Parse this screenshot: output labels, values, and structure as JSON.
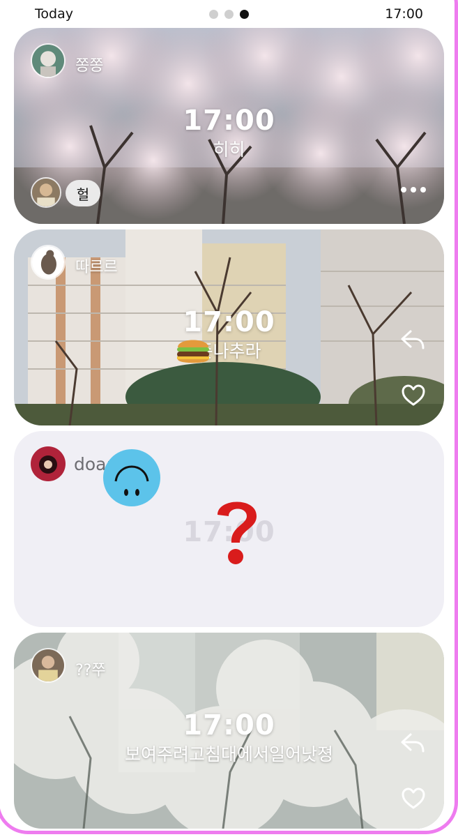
{
  "status_bar": {
    "left_label": "Today",
    "time": "17:00"
  },
  "cards": [
    {
      "username": "쫑쫑",
      "time": "17:00",
      "caption": "히히",
      "reaction_text": "헐",
      "photo": "cherry-blossom-trees"
    },
    {
      "username": "따르르",
      "time": "17:00",
      "caption": "준나추라",
      "sticker": "burger-emoji",
      "photo": "apartment-buildings-bare-trees"
    },
    {
      "username": "doaang...",
      "time": "17:00",
      "stickers": [
        "upside-down-smiley",
        "red-question-mark"
      ]
    },
    {
      "username": "??쭈",
      "time": "17:00",
      "caption": "보여주려고침대에서일어낫졍",
      "photo": "hazy-cherry-blossom-apartments"
    }
  ],
  "colors": {
    "frame_accent": "#ee7cef",
    "empty_card_bg": "#f0eff5",
    "active_dot": "#111111"
  }
}
